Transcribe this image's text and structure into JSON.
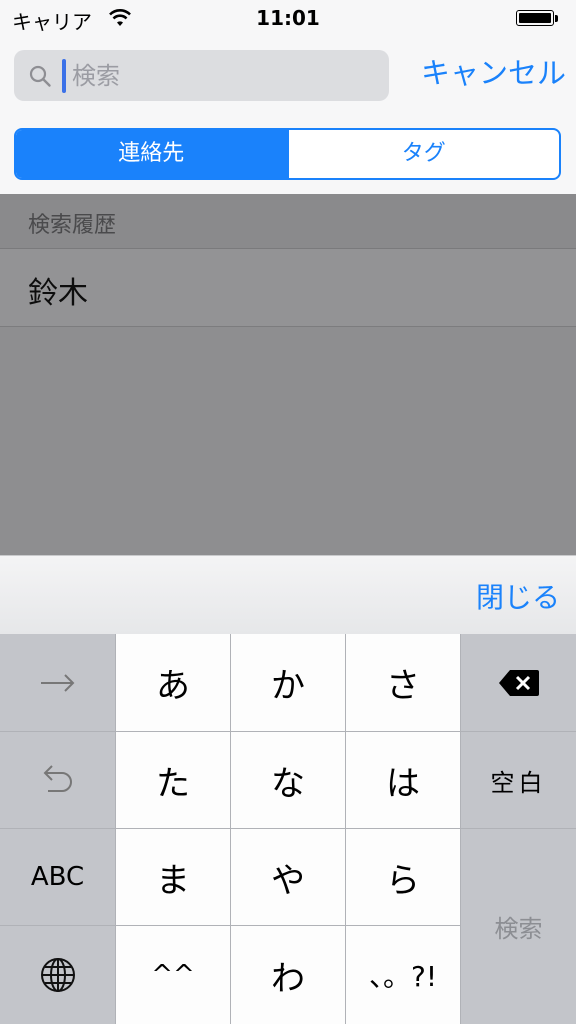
{
  "status_bar": {
    "carrier": "キャリア",
    "time": "11:01"
  },
  "search": {
    "placeholder": "検索",
    "value": "",
    "cancel_label": "キャンセル"
  },
  "segments": [
    {
      "label": "連絡先",
      "selected": true
    },
    {
      "label": "タグ",
      "selected": false
    }
  ],
  "history": {
    "header": "検索履歴",
    "items": [
      "鈴木"
    ]
  },
  "toolbar": {
    "close_label": "閉じる"
  },
  "keyboard": {
    "keys": {
      "a": "あ",
      "ka": "か",
      "sa": "さ",
      "ta": "た",
      "na": "な",
      "ha": "は",
      "ma": "ま",
      "ya": "や",
      "ra": "ら",
      "emoticon": "^^",
      "wa": "わ",
      "punct": "、。?!",
      "space": "空白",
      "abc": "ABC",
      "search": "検索"
    },
    "icons": {
      "next": "arrow-right-icon",
      "undo": "undo-icon",
      "globe": "globe-icon",
      "delete": "delete-icon"
    }
  },
  "colors": {
    "accent": "#1a82fb",
    "dim_overlay": "#8e8e90",
    "keyboard_bg": "#c5c7cc"
  }
}
